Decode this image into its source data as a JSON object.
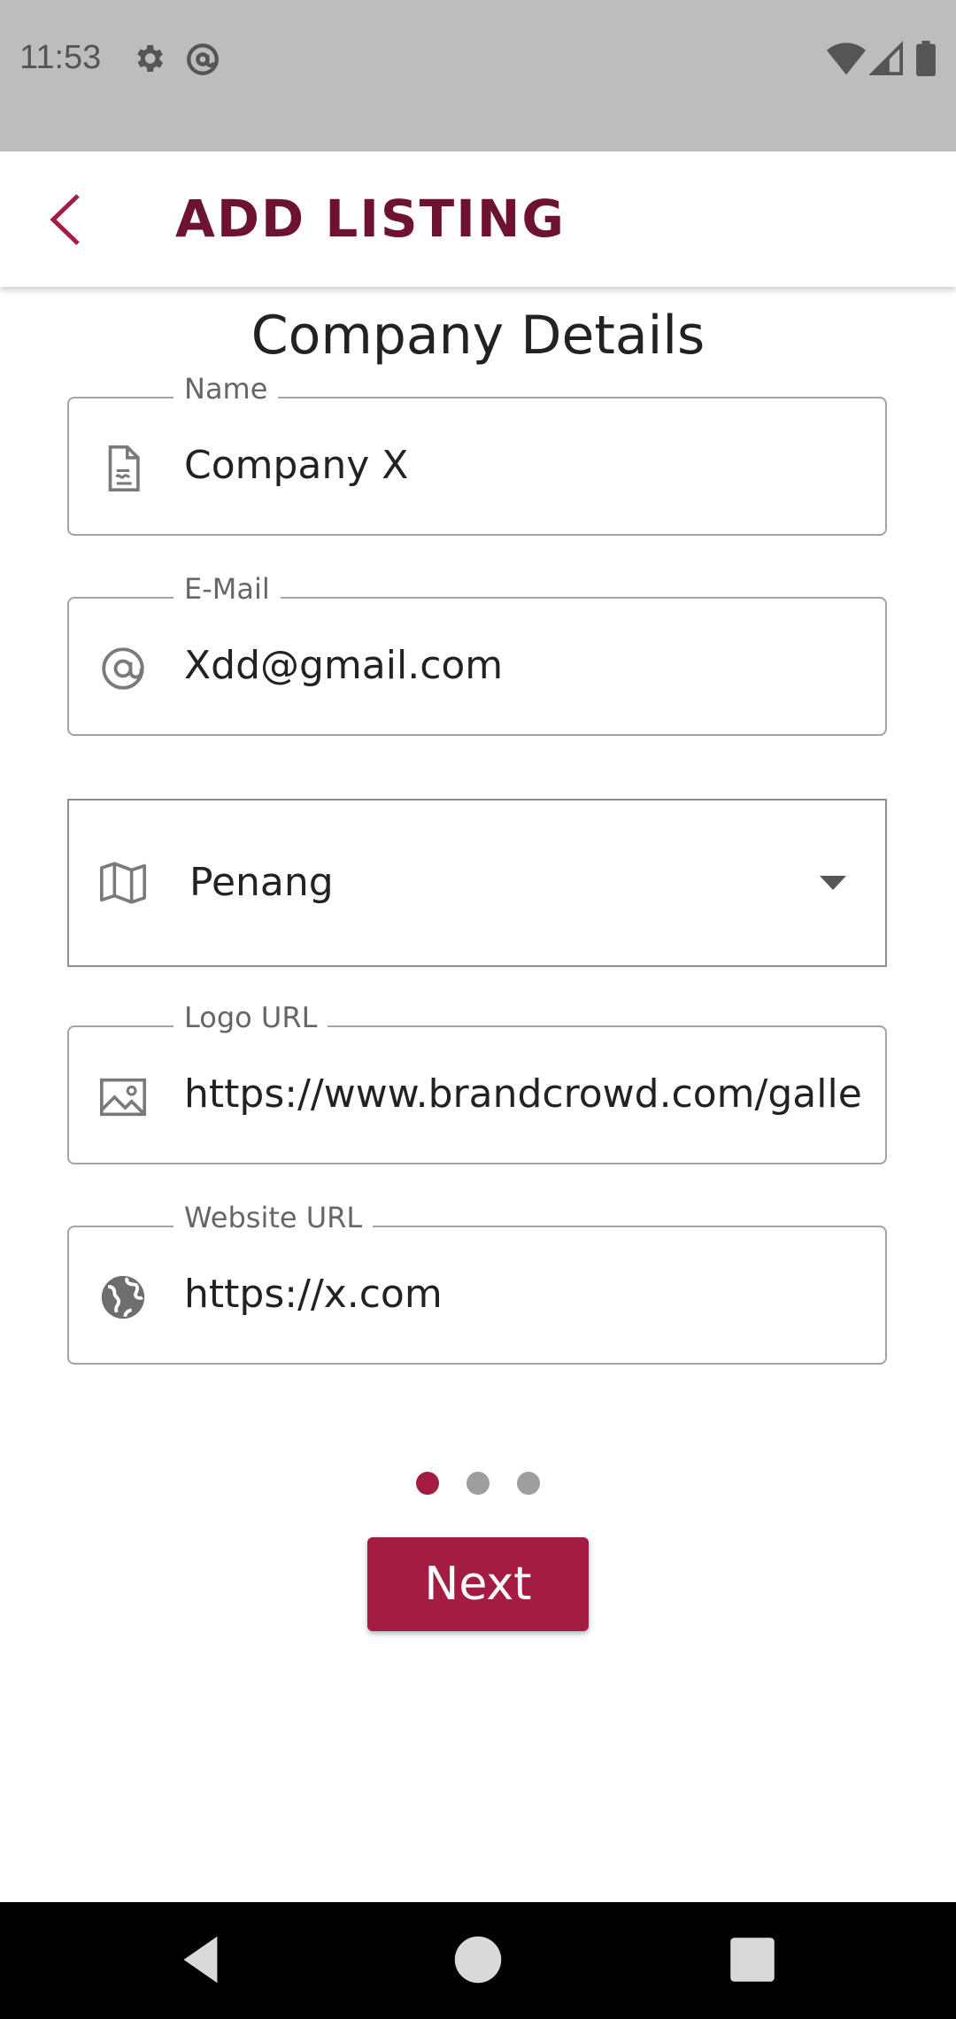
{
  "status_bar": {
    "time": "11:53",
    "left_icons": [
      "gear-icon",
      "at-sign-icon"
    ],
    "right_icons": [
      "wifi-icon",
      "signal-icon",
      "battery-icon"
    ]
  },
  "app_bar": {
    "title": "ADD LISTING",
    "back_icon": "chevron-left-icon"
  },
  "form": {
    "section_title": "Company Details",
    "name": {
      "label": "Name",
      "value": "Company X",
      "icon": "document-icon"
    },
    "email": {
      "label": "E-Mail",
      "value": "Xdd@gmail.com",
      "icon": "at-icon"
    },
    "state": {
      "value": "Penang",
      "icon": "map-icon"
    },
    "logo_url": {
      "label": "Logo URL",
      "value": "https://www.brandcrowd.com/galle",
      "icon": "image-icon"
    },
    "website_url": {
      "label": "Website URL",
      "value": "https://x.com",
      "icon": "globe-icon"
    }
  },
  "pager": {
    "total": 3,
    "active": 1
  },
  "next_label": "Next",
  "colors": {
    "accent": "#a51c43",
    "title": "#6d1232",
    "dot_inactive": "#9e9e9e",
    "status_bar": "#bdbdbd"
  }
}
